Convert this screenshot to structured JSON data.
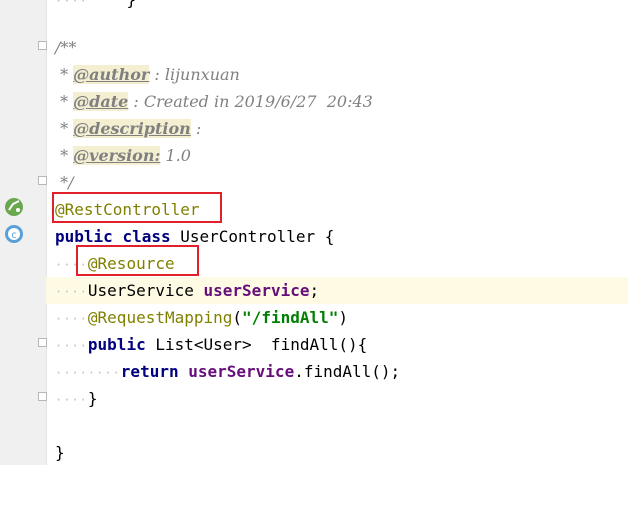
{
  "editor": {
    "lines": [
      {
        "id": "l0",
        "text": "    }"
      },
      {
        "id": "l1",
        "text": "/**"
      },
      {
        "id": "l2a",
        "text": " * ",
        "tag": "@author",
        "rest": " : lijunxuan"
      },
      {
        "id": "l3a",
        "text": " * ",
        "tag": "@date",
        "rest": " : Created in 2019/6/27  20:43"
      },
      {
        "id": "l4a",
        "text": " * ",
        "tag": "@description",
        "rest": " :"
      },
      {
        "id": "l5a",
        "text": " * ",
        "tag": "@version:",
        "rest": " 1.0"
      },
      {
        "id": "l6",
        "text": " */"
      },
      {
        "id": "l7",
        "text": "@RestController"
      },
      {
        "id": "l8",
        "kw1": "public",
        "kw2": "class",
        "rest": " UserController {"
      },
      {
        "id": "l9",
        "text": "@Resource"
      },
      {
        "id": "l10",
        "type": "UserService",
        "field": "userService",
        "end": ";"
      },
      {
        "id": "l11",
        "ann": "@RequestMapping",
        "open": "(",
        "str": "\"/findAll\"",
        "close": ")"
      },
      {
        "id": "l12",
        "kw": "public",
        "rest": " List<User>  findAll(){"
      },
      {
        "id": "l13",
        "kw": "return",
        "field": "userService",
        "rest": ".findAll();"
      },
      {
        "id": "l14",
        "text": "}"
      },
      {
        "id": "l15",
        "text": "}"
      }
    ]
  },
  "gutter": {
    "icons": [
      "spring-bean-icon",
      "class-implemented-icon"
    ]
  },
  "colors": {
    "highlight_box": "#e0202a",
    "annotation": "#808000",
    "keyword": "#000080",
    "field": "#660e7a",
    "string": "#008000"
  }
}
